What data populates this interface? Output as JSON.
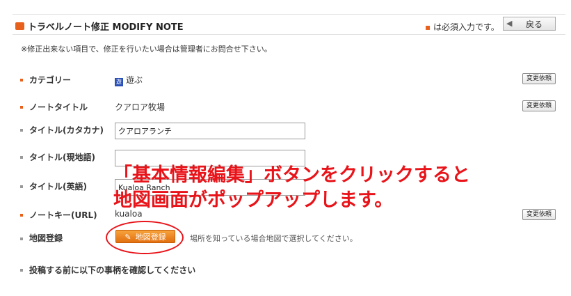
{
  "header": {
    "title": "トラベルノート修正 MODIFY NOTE",
    "required_mark": "▪",
    "required_note": "は必須入力です。",
    "back_arrow": "◀",
    "back_label": "戻る"
  },
  "notice": "※修正出来ない項目で、修正を行いたい場合は管理者にお問合せ下さい。",
  "fields": {
    "category": {
      "label": "カテゴリー",
      "icon_text": "遊",
      "value": "遊ぶ",
      "button": "変更依頼"
    },
    "note_title": {
      "label": "ノートタイトル",
      "value": "クアロア牧場",
      "button": "変更依頼"
    },
    "title_kana": {
      "label": "タイトル(カタカナ)",
      "value": "クアロアランチ"
    },
    "title_local": {
      "label": "タイトル(現地語)",
      "value": ""
    },
    "title_english": {
      "label": "タイトル(英語)",
      "value": "Kualoa Ranch"
    },
    "note_key": {
      "label": "ノートキー(URL)",
      "value": "kualoa",
      "button": "変更依頼"
    },
    "map": {
      "label": "地図登録",
      "button": "地図登録",
      "pen_icon": "✎",
      "hint": "場所を知っている場合地図で選択してください。"
    },
    "confirm": {
      "label": "投稿する前に以下の事柄を確認してください"
    }
  },
  "overlay": {
    "line1": "「基本情報編集」ボタンをクリックすると",
    "line2": "地図画面がポップアップします。"
  },
  "colors": {
    "accent": "#e8611c",
    "annotation": "#e8141a"
  }
}
